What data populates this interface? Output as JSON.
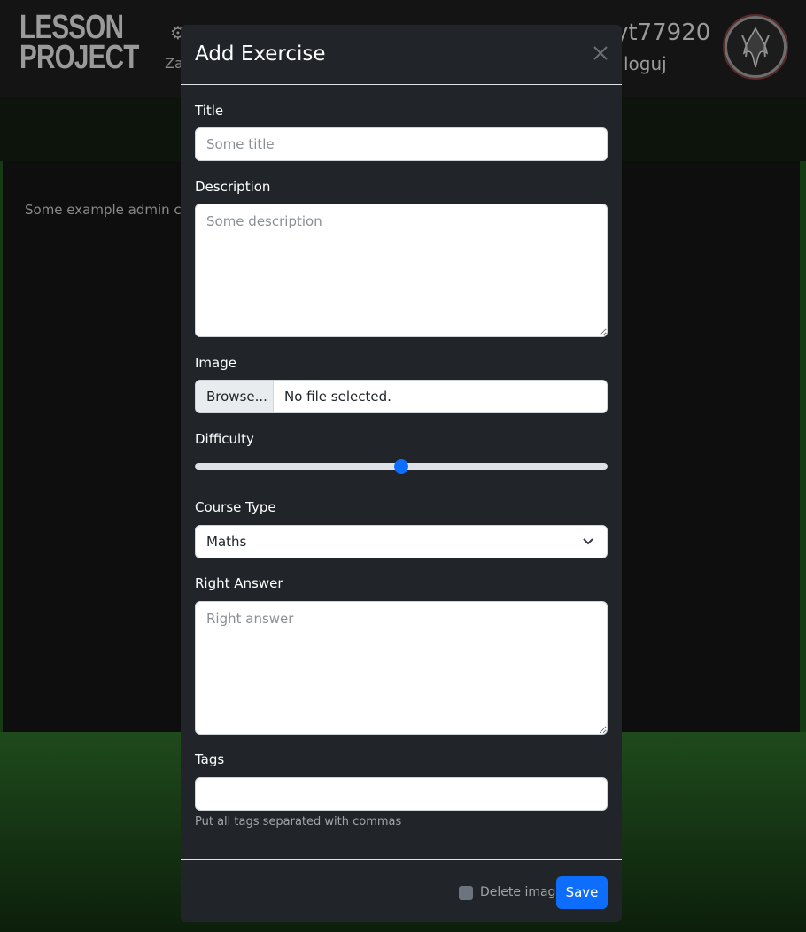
{
  "background": {
    "logo": {
      "line1": "LESSON",
      "line2": "PROJECT"
    },
    "nav": {
      "partial_label": "Za"
    },
    "user": {
      "name": "yt77920",
      "logout_label": "loguj"
    },
    "admin_text": "Some example admin cont",
    "colors": {
      "page_bg": "#0f0f0f",
      "green_band": "#163a14"
    }
  },
  "modal": {
    "title": "Add Exercise",
    "close_icon": "close-icon",
    "fields": {
      "title": {
        "label": "Title",
        "placeholder": "Some title",
        "value": ""
      },
      "description": {
        "label": "Description",
        "placeholder": "Some description",
        "value": ""
      },
      "image": {
        "label": "Image",
        "button_label": "Browse...",
        "status": "No file selected."
      },
      "difficulty": {
        "label": "Difficulty",
        "value_fraction": 0.5
      },
      "course_type": {
        "label": "Course Type",
        "selected": "Maths"
      },
      "right_answer": {
        "label": "Right Answer",
        "placeholder": "Right answer",
        "value": ""
      },
      "tags": {
        "label": "Tags",
        "value": "",
        "help": "Put all tags separated with commas"
      }
    },
    "footer": {
      "delete_image_label": "Delete image",
      "delete_image_checked": false,
      "save_label": "Save"
    },
    "colors": {
      "modal_bg": "#212529",
      "accent": "#0d6efd"
    }
  }
}
